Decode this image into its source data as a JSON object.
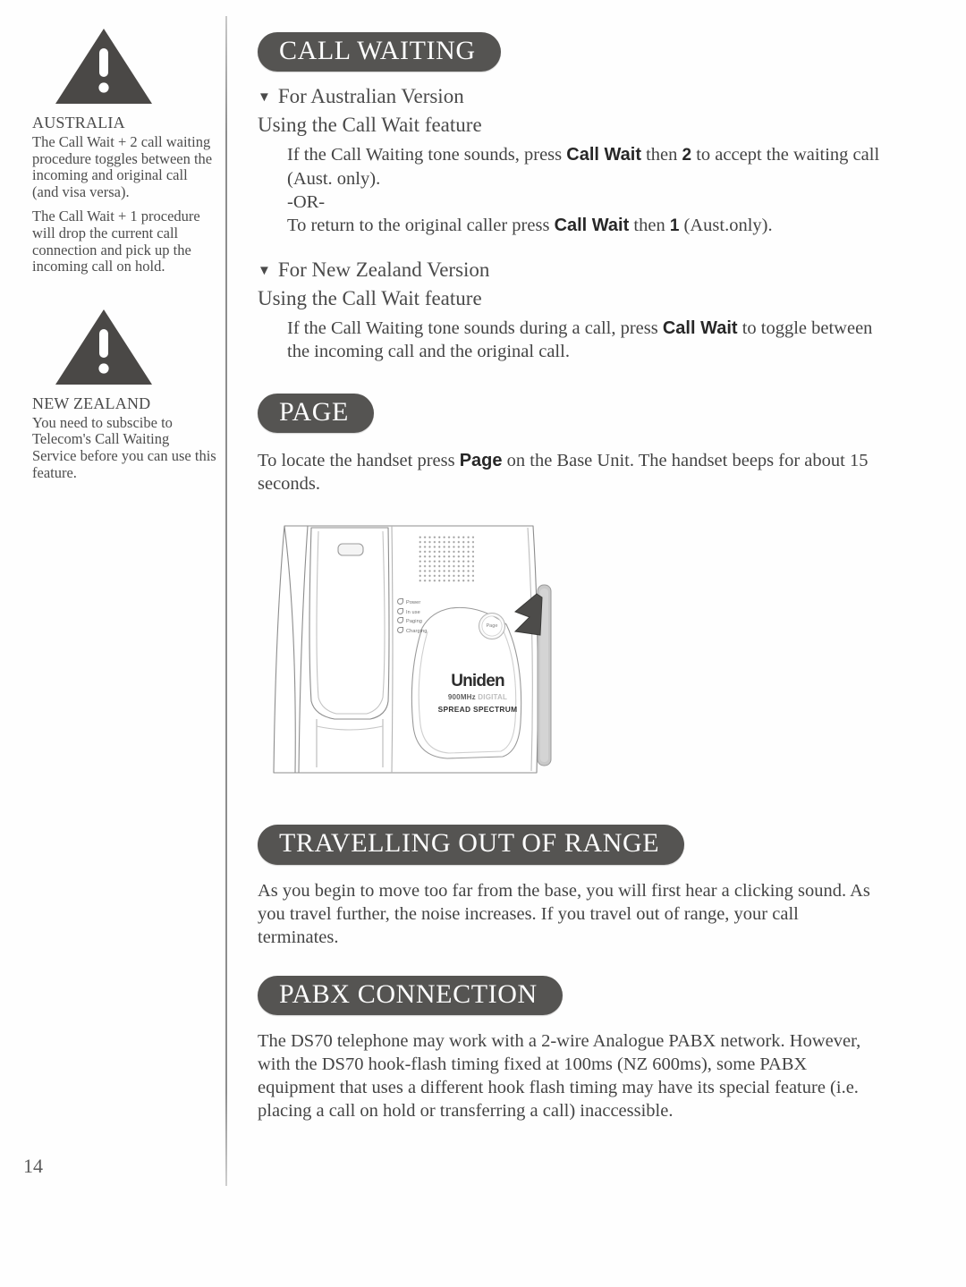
{
  "page": {
    "number": "14"
  },
  "sidebar": {
    "notices": [
      {
        "icon": "warning-triangle-icon",
        "region": "AUSTRALIA",
        "paragraphs": [
          "The Call Wait + 2 call waiting procedure toggles between the incoming and original call (and visa versa).",
          "The Call Wait + 1 procedure will drop the current call connection and pick up the incoming call on hold."
        ]
      },
      {
        "icon": "warning-triangle-icon",
        "region": "NEW ZEALAND",
        "paragraphs": [
          "You need to subscibe to Telecom's Call Waiting Service before you can use this feature."
        ]
      }
    ]
  },
  "sections": {
    "call_waiting": {
      "heading": "CALL WAITING",
      "australian": {
        "marker": "▼",
        "version_label": "For Australian Version",
        "feature_label": "Using the Call Wait feature",
        "para1_a": "If the Call Waiting tone sounds, press ",
        "para1_key": "Call Wait",
        "para1_b": " then ",
        "para1_digit": "2",
        "para1_c": " to accept the waiting call (Aust. only).",
        "or_label": "-OR-",
        "para2_a": "To return to the original caller press ",
        "para2_key": "Call Wait",
        "para2_b": " then ",
        "para2_digit": "1",
        "para2_c": " (Aust.only)."
      },
      "new_zealand": {
        "marker": "▼",
        "version_label": "For New Zealand Version",
        "feature_label": "Using the Call Wait feature",
        "para1_a": "If the Call Waiting tone sounds during a call, press ",
        "para1_key": "Call Wait",
        "para1_b": " to toggle between the incoming call and the original call."
      }
    },
    "page_section": {
      "heading": "PAGE",
      "para_a": "To locate the handset press ",
      "para_key": "Page",
      "para_b": " on the Base Unit.  The handset beeps for about 15 seconds.",
      "illustration": {
        "name": "base-unit-illustration",
        "leds": [
          "Power",
          "In use",
          "Paging",
          "Charging"
        ],
        "page_button_label": "Page",
        "brand": "Uniden",
        "brand_line2_bold": "900MHz ",
        "brand_line2_faint": "DIGITAL",
        "brand_line3": "SPREAD SPECTRUM",
        "callout": "antenna-arrow"
      }
    },
    "travelling": {
      "heading": "TRAVELLING OUT OF RANGE",
      "paragraph": "As you begin to move too far from the base, you will first hear a clicking sound. As you travel further, the noise increases. If you travel out of range, your call terminates."
    },
    "pabx": {
      "heading": "PABX CONNECTION",
      "paragraph": "The DS70 telephone may work with a 2-wire Analogue PABX network. However, with the DS70 hook-flash timing fixed at 100ms (NZ 600ms), some  PABX equipment that uses a different hook flash timing may have its special feature (i.e. placing a call on hold or transferring a call) inaccessible."
    }
  },
  "colors": {
    "heading_pill": "#555452",
    "warning_icon": "#4a4846",
    "body_text": "#444444",
    "page_background": "#fefefe"
  }
}
